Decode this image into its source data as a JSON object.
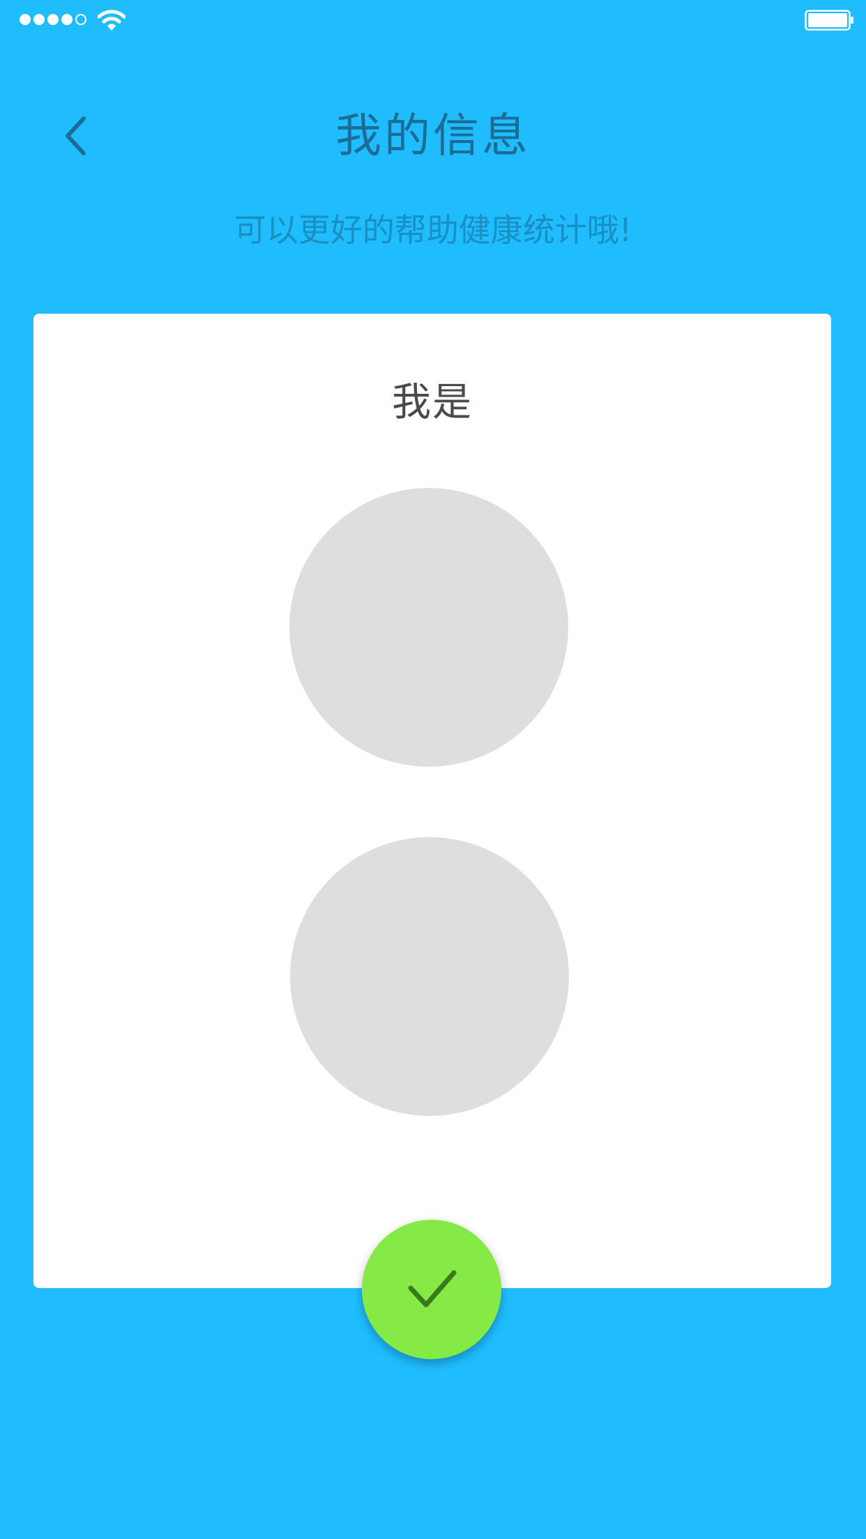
{
  "colors": {
    "background": "#1FBDFE",
    "title": "#1C6D96",
    "subtitle": "#1A8FC4",
    "card": "#FFFFFF",
    "option_placeholder": "#DEDEDE",
    "confirm": "#85EA46",
    "confirm_check": "#3A7A1A"
  },
  "status_bar": {
    "signal_icon": "signal-dots-icon",
    "wifi_icon": "wifi-icon",
    "battery_icon": "battery-icon"
  },
  "header": {
    "back_icon": "chevron-left-icon",
    "title": "我的信息",
    "subtitle": "可以更好的帮助健康统计哦!"
  },
  "card": {
    "title": "我是",
    "options": [
      "",
      ""
    ]
  },
  "confirm": {
    "icon": "checkmark-icon"
  }
}
